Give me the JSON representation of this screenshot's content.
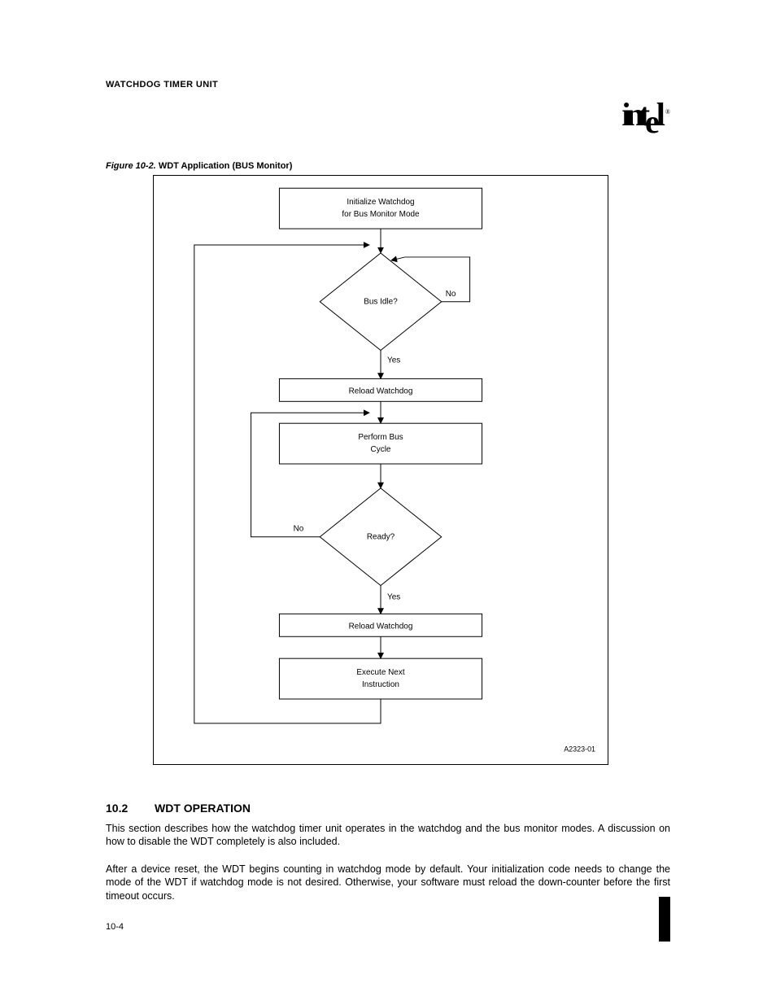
{
  "header": {
    "title": "WATCHDOG TIMER UNIT"
  },
  "logo": {
    "text": "intel",
    "reg": "®"
  },
  "figure": {
    "label": "Figure 10-2.",
    "caption": "WDT Application (BUS Monitor)",
    "id": "A2323-01"
  },
  "flow": {
    "b1": {
      "l1": "Initialize Watchdog",
      "l2": "for Bus Monitor Mode"
    },
    "d1": {
      "label": "Bus Idle?",
      "yes": "Yes",
      "no": "No"
    },
    "b2": {
      "l1": "Reload Watchdog"
    },
    "b3": {
      "l1": "Perform Bus",
      "l2": "Cycle"
    },
    "d2": {
      "label": "Ready?",
      "yes": "Yes",
      "no": "No"
    },
    "b4": {
      "l1": "Reload Watchdog"
    },
    "b5": {
      "l1": "Execute Next",
      "l2": "Instruction"
    }
  },
  "section": {
    "num": "10.2",
    "title": "WDT OPERATION"
  },
  "paras": {
    "p1": "This section describes how the watchdog timer unit operates in the watchdog and the bus monitor modes. A discussion on how to disable the WDT completely is also included.",
    "p2": "After a device reset, the WDT begins counting in watchdog mode by default. Your initialization code needs to change the mode of the WDT if watchdog mode is not desired. Otherwise, your software must reload the down-counter before the first timeout occurs."
  },
  "page": "10-4"
}
